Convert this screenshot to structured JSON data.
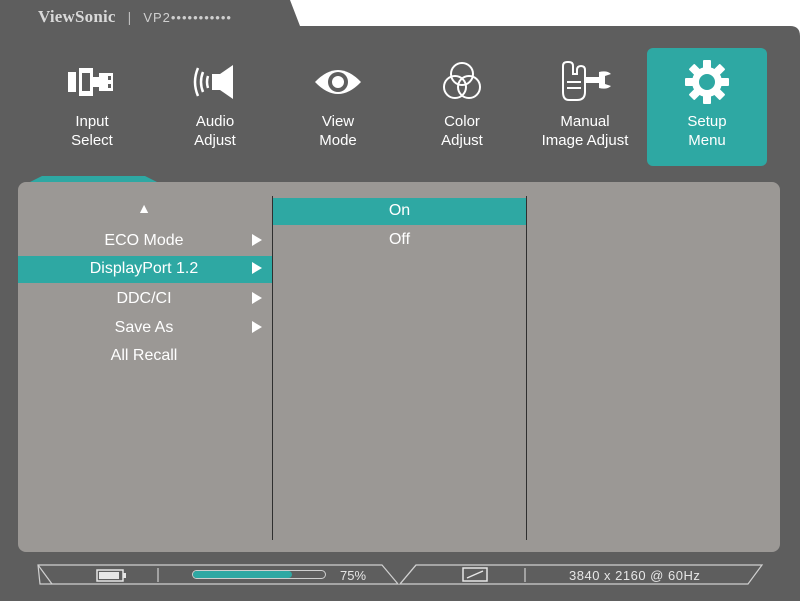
{
  "brand": {
    "logo": "ViewSonic",
    "separator": "|",
    "model": "VP2•••••••••••"
  },
  "tabs": [
    {
      "line1": "Input",
      "line2": "Select",
      "icon": "input-select-icon"
    },
    {
      "line1": "Audio",
      "line2": "Adjust",
      "icon": "speaker-icon"
    },
    {
      "line1": "View",
      "line2": "Mode",
      "icon": "eye-icon"
    },
    {
      "line1": "Color",
      "line2": "Adjust",
      "icon": "color-circles-icon"
    },
    {
      "line1": "Manual",
      "line2": "Image Adjust",
      "icon": "hand-wrench-icon"
    },
    {
      "line1": "Setup",
      "line2": "Menu",
      "icon": "gear-icon",
      "active": true
    }
  ],
  "menu": {
    "up_arrow": "▲",
    "items": [
      {
        "label": "ECO Mode",
        "has_submenu": true
      },
      {
        "label": "DisplayPort 1.2",
        "has_submenu": true,
        "selected": true
      },
      {
        "label": "DDC/CI",
        "has_submenu": true
      },
      {
        "label": "Save As",
        "has_submenu": true
      },
      {
        "label": "All Recall",
        "has_submenu": false
      }
    ]
  },
  "submenu": {
    "items": [
      {
        "label": "On",
        "selected": true
      },
      {
        "label": "Off"
      }
    ]
  },
  "status": {
    "battery_icon": "battery-icon",
    "progress_value": 0.75,
    "progress_label": "75%",
    "aspect_icon": "aspect-ratio-icon",
    "resolution": "3840 x 2160 @ 60Hz"
  },
  "colors": {
    "accent": "#2ea8a3",
    "frame": "#5e5e5e",
    "panel": "#9b9895",
    "text": "#ffffff"
  }
}
